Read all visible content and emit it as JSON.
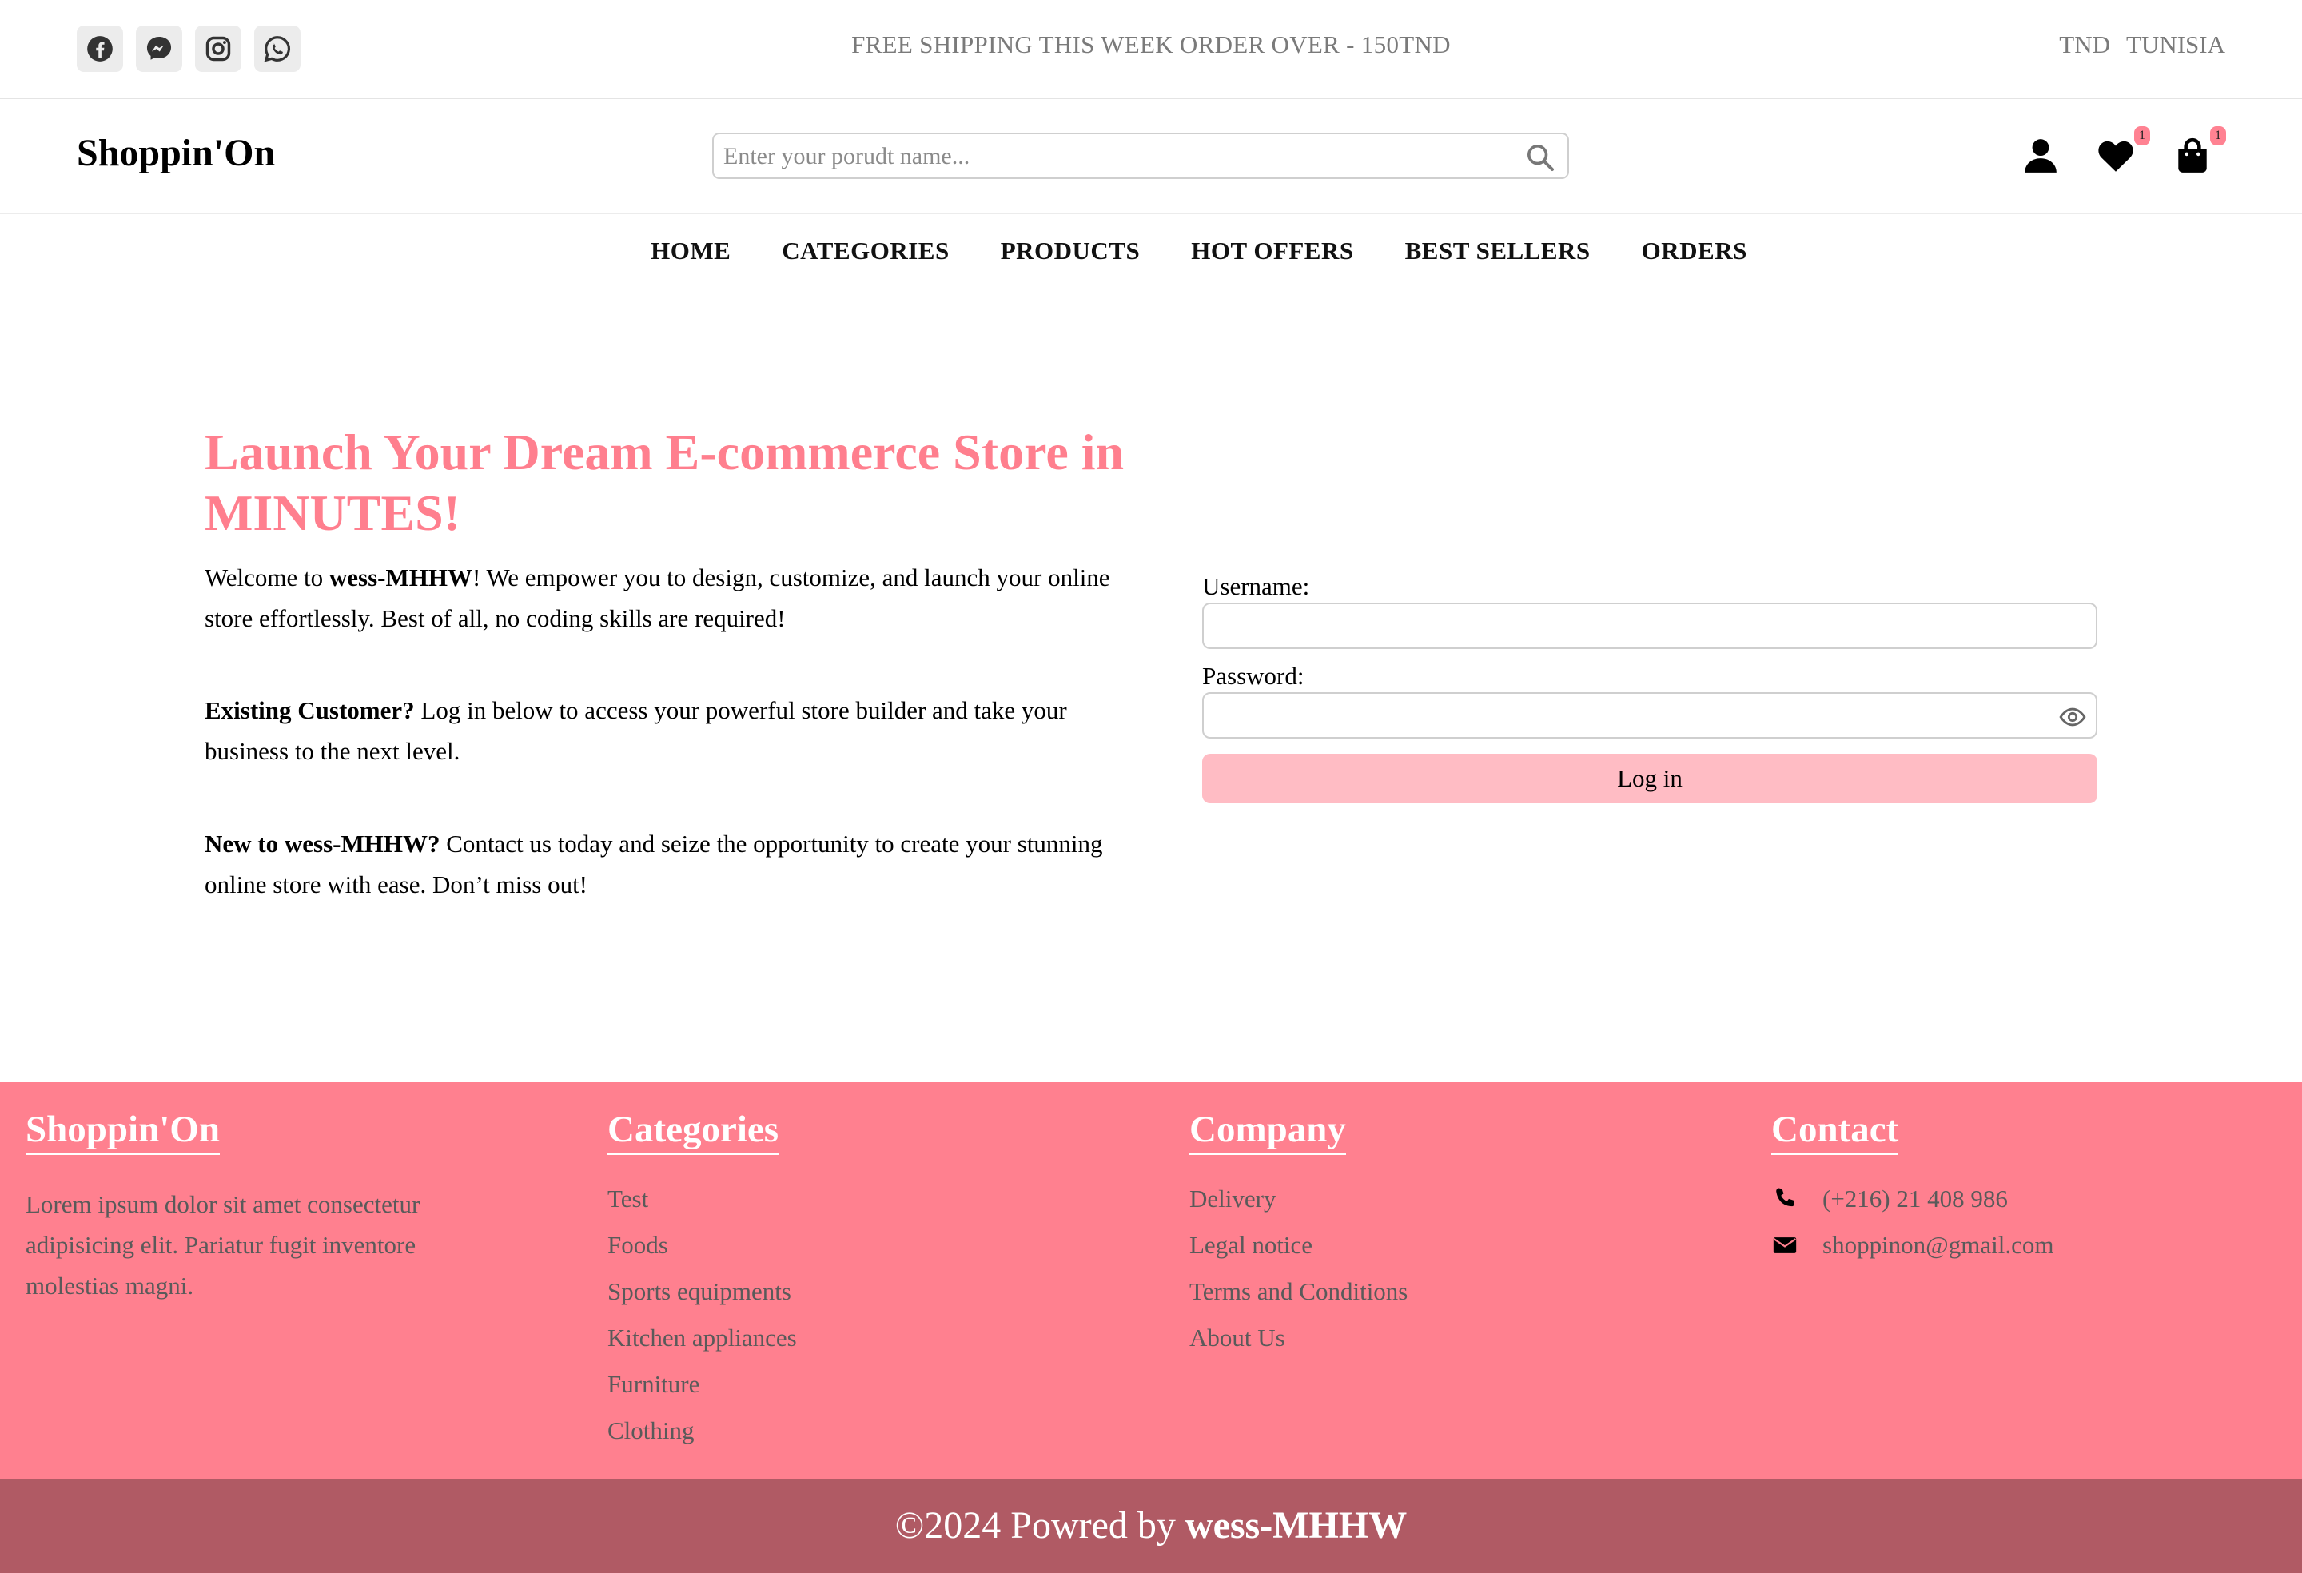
{
  "topbar": {
    "socials": [
      "facebook-icon",
      "messenger-icon",
      "instagram-icon",
      "whatsapp-icon"
    ],
    "shipping_text": "FREE SHIPPING THIS WEEK ORDER OVER - 150TND",
    "currency": "TND",
    "country": "TUNISIA"
  },
  "header": {
    "logo": "Shoppin'On",
    "search_placeholder": "Enter your porudt name...",
    "wishlist_count": "1",
    "cart_count": "1"
  },
  "nav": {
    "items": [
      "HOME",
      "CATEGORIES",
      "PRODUCTS",
      "HOT OFFERS",
      "BEST SELLERS",
      "ORDERS"
    ]
  },
  "hero": {
    "title": "Launch Your Dream E-commerce Store in MINUTES!",
    "welcome_prefix": "Welcome to ",
    "brand": "wess-MHHW",
    "welcome_suffix": "! We empower you to design, customize, and launch your online store effortlessly. Best of all, no coding skills are required!",
    "existing_bold": "Existing Customer?",
    "existing_text": " Log in below to access your powerful store builder and take your business to the next level.",
    "new_bold": "New to wess-MHHW?",
    "new_text": " Contact us today and seize the opportunity to create your stunning online store with ease. Don’t miss out!"
  },
  "login": {
    "username_label": "Username:",
    "password_label": "Password:",
    "username_value": "",
    "password_value": "",
    "button": "Log in"
  },
  "footer": {
    "brand": {
      "heading": "Shoppin'On",
      "text": "Lorem ipsum dolor sit amet consectetur adipisicing elit. Pariatur fugit inventore molestias magni."
    },
    "categories": {
      "heading": "Categories",
      "items": [
        "Test",
        "Foods",
        "Sports equipments",
        "Kitchen appliances",
        "Furniture",
        "Clothing"
      ]
    },
    "company": {
      "heading": "Company",
      "items": [
        "Delivery",
        "Legal notice",
        "Terms and Conditions",
        "About Us"
      ]
    },
    "contact": {
      "heading": "Contact",
      "phone": "(+216) 21 408 986",
      "email": "shoppinon@gmail.com"
    },
    "copyright_prefix": "©2024 Powred by ",
    "copyright_brand": "wess-MHHW"
  },
  "colors": {
    "accent": "#ff7f8e",
    "footer_bg": "#ff808f",
    "bottom_bar": "#b05a64",
    "button_bg": "#ffbcc4"
  }
}
